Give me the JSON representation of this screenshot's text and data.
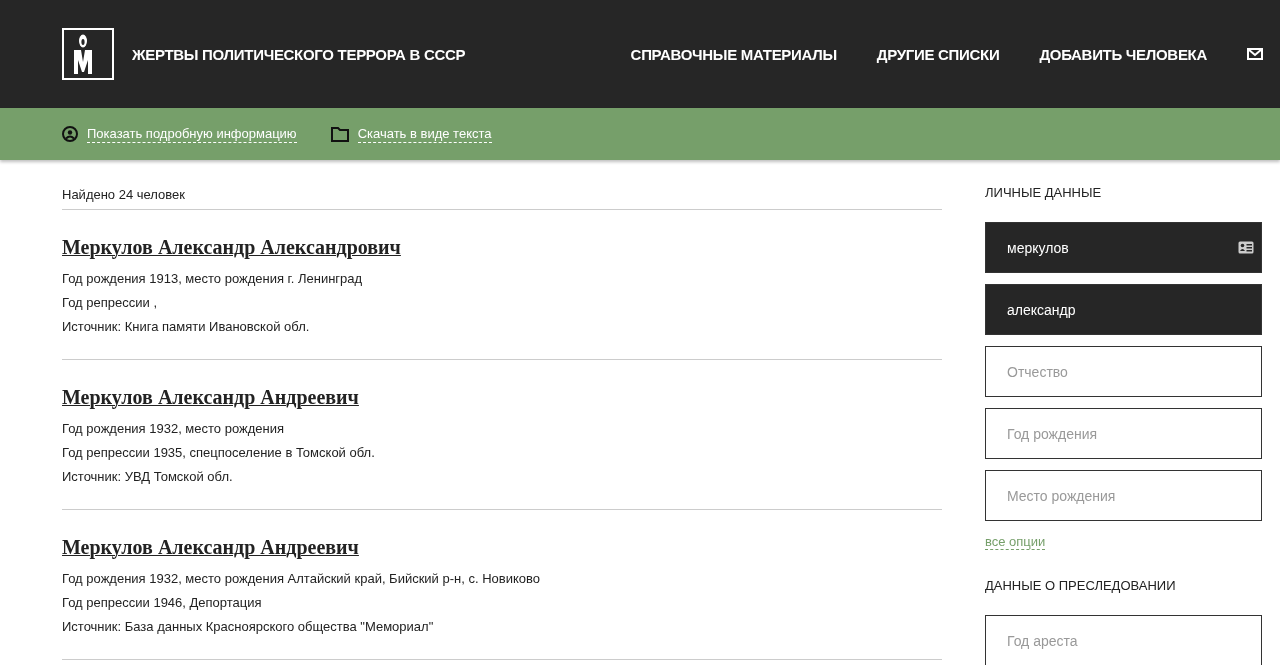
{
  "header": {
    "title": "ЖЕРТВЫ ПОЛИТИЧЕСКОГО ТЕРРОРА В СССР",
    "nav": [
      "СПРАВОЧНЫЕ МАТЕРИАЛЫ",
      "ДРУГИЕ СПИСКИ",
      "ДОБАВИТЬ ЧЕЛОВЕКА"
    ]
  },
  "toolbar": [
    {
      "kind": "person",
      "label": "Показать подробную информацию"
    },
    {
      "kind": "folder",
      "label": "Скачать в виде текста"
    }
  ],
  "results": {
    "count": "Найдено 24 человек",
    "items": [
      {
        "name": "Меркулов Александр Александрович",
        "lines": [
          "Год рождения 1913, место рождения г. Ленинград",
          "Год репрессии ,",
          "Источник: Книга памяти Ивановской обл."
        ]
      },
      {
        "name": "Меркулов Александр Андреевич",
        "lines": [
          "Год рождения 1932, место рождения",
          "Год репрессии 1935, спецпоселение в Томской обл.",
          "Источник: УВД Томской обл."
        ]
      },
      {
        "name": "Меркулов Александр Андреевич",
        "lines": [
          "Год рождения 1932, место рождения Алтайский край, Бийский р-н, с. Новиково",
          "Год репрессии 1946, Депортация",
          "Источник: База данных Красноярского общества \"Мемориал\""
        ]
      }
    ]
  },
  "sidebar": {
    "sections": [
      {
        "title": "ЛИЧНЫЕ ДАННЫЕ",
        "fields": [
          {
            "kind": "card",
            "value": "меркулов"
          },
          {
            "kind": "plain",
            "value": "александр"
          },
          {
            "kind": "plain",
            "placeholder": "Отчество"
          },
          {
            "kind": "plain",
            "placeholder": "Год рождения"
          },
          {
            "kind": "plain",
            "placeholder": "Место рождения"
          }
        ],
        "link": "все опции"
      },
      {
        "title": "ДАННЫЕ О ПРЕСЛЕДОВАНИИ",
        "fields": [
          {
            "kind": "plain",
            "placeholder": "Год ареста"
          }
        ]
      }
    ]
  }
}
